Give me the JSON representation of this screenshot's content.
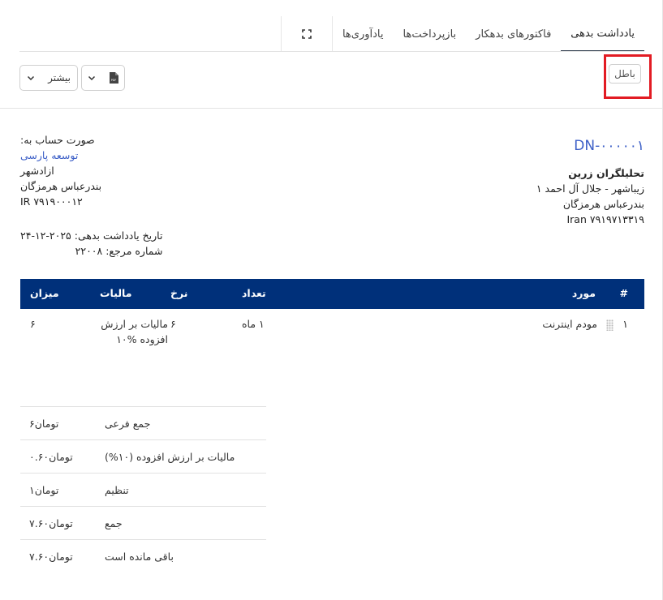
{
  "tabs": [
    {
      "label": "یادداشت بدهی"
    },
    {
      "label": "فاکتورهای بدهکار"
    },
    {
      "label": "بازپرداخت‌ها"
    },
    {
      "label": "یادآوری‌ها"
    }
  ],
  "toolbar": {
    "more_label": "بیشتر",
    "pdf_icon_label": "PDF",
    "void_label": "باطل"
  },
  "invoice": {
    "number": "DN-۰۰۰۰۰۱",
    "from": {
      "name": "تحلیلگران زرین",
      "line1": "زیباشهر - جلال آل احمد ۱",
      "line2": "بندرعباس هرمزگان",
      "line3": "Iran ۷۹۱۹۷۱۳۳۱۹"
    },
    "bill_to": {
      "label": "صورت حساب به:",
      "name": "توسعه پارسی",
      "line1": "ازادشهر",
      "line2": "بندرعباس هرمزگان",
      "line3": "IR ۷۹۱۹۰۰۰۱۲"
    },
    "date_line": "تاریخ یادداشت بدهی: ۲۰۲۵-۱۲-۲۴",
    "ref_line": "شماره مرجع: ۲۲۰۰۸"
  },
  "table": {
    "headers": {
      "num": "#",
      "item": "مورد",
      "qty": "تعداد",
      "rate": "نرخ",
      "tax": "مالیات",
      "amount": "میزان"
    },
    "rows": [
      {
        "num": "۱",
        "item": "مودم اینترنت",
        "qty": "۱ ماه",
        "rate": "۶",
        "tax": "مالیات بر ارزش افزوده %۱۰",
        "amount": "۶"
      }
    ]
  },
  "totals": [
    {
      "label": "جمع فرعی",
      "value": "۶تومان"
    },
    {
      "label": "مالیات بر ارزش افزوده (۱۰%)",
      "value": "۰.۶۰تومان"
    },
    {
      "label": "تنظیم",
      "value": "۱تومان"
    },
    {
      "label": "جمع",
      "value": "۷.۶۰تومان"
    },
    {
      "label": "باقی مانده است",
      "value": "۷.۶۰تومان"
    }
  ]
}
